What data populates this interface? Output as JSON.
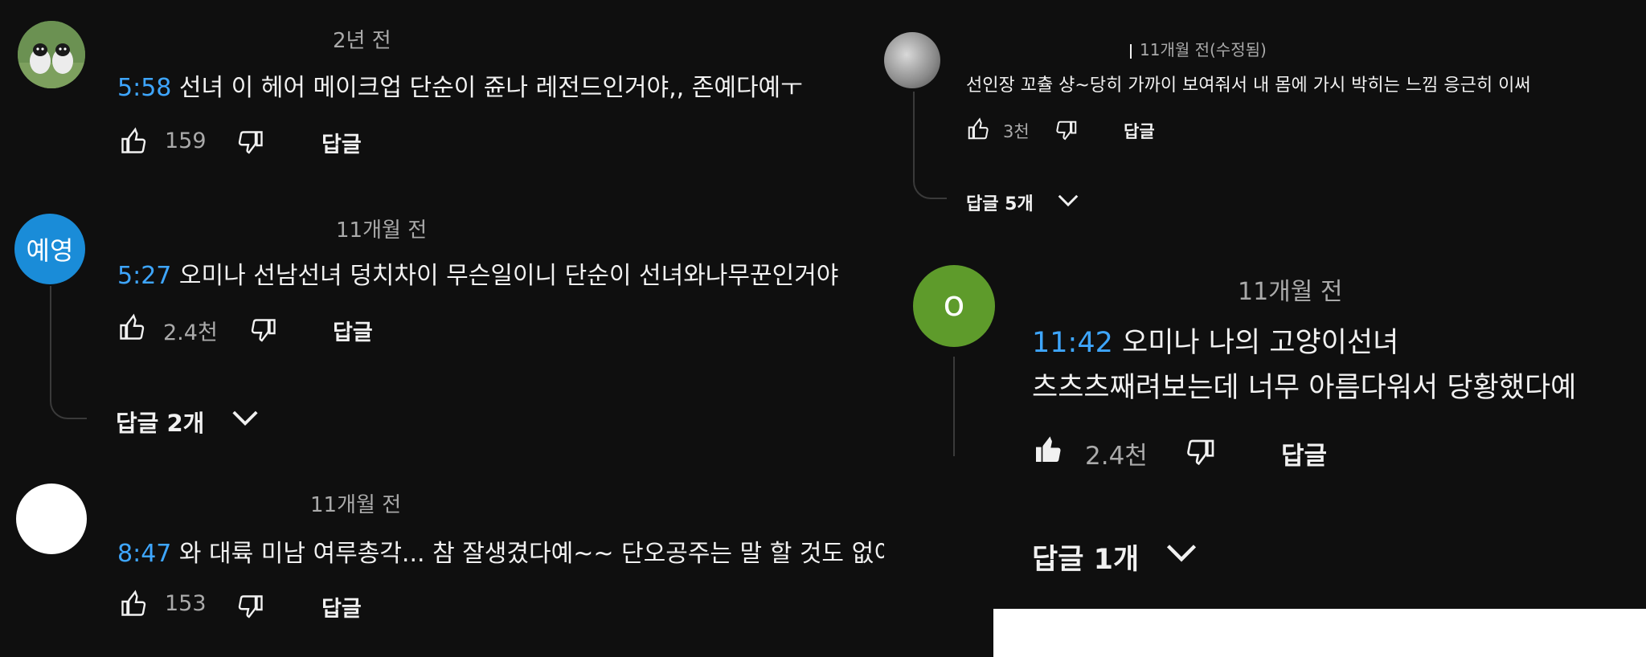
{
  "left": {
    "comments": [
      {
        "time_ago": "2년 전",
        "timestamp": "5:58",
        "text": "선녀 이 헤어 메이크업 단순이 쥰나 레전드인거야,, 존예다예ㅜ",
        "likes": "159",
        "reply_label": "답글",
        "avatar_icon": "sheep-avatar-icon"
      },
      {
        "avatar_text": "예영",
        "avatar_color": "#1a8cd8",
        "time_ago": "11개월 전",
        "timestamp": "5:27",
        "text": "오미나 선남선녀 덩치차이 무슨일이니 단순이 선녀와나무꾼인거야",
        "likes": "2.4천",
        "reply_label": "답글",
        "replies_label": "답글 2개"
      },
      {
        "time_ago": "11개월 전",
        "timestamp": "8:47",
        "text": "와 대륙 미남 여루총각... 참 잘생겼다예~~ 단오공주는 말 할 것도 없이 퀸",
        "likes": "153",
        "reply_label": "답글"
      }
    ]
  },
  "right": {
    "comments": [
      {
        "time_ago": "11개월 전(수정됨)",
        "text": "선인장 꼬츌 샹~당히 가까이 보여줘서 내 몸에 가시 박히는 느낌 응근히 이써",
        "likes": "3천",
        "reply_label": "답글",
        "replies_label": "답글 5개"
      },
      {
        "avatar_text": "o",
        "avatar_color": "#5e9b2b",
        "time_ago": "11개월 전",
        "timestamp": "11:42",
        "text_line1": "오미나 나의 고양이선녀",
        "text_line2": "츠츠츠째려보는데 너무 아름다워서 당황했다예",
        "likes": "2.4천",
        "reply_label": "답글",
        "replies_label": "답글 1개"
      }
    ]
  }
}
